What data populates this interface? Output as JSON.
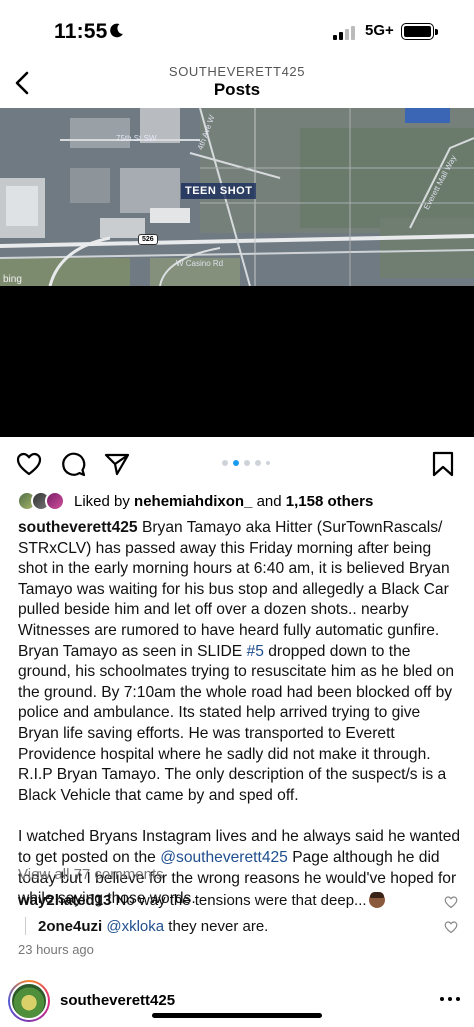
{
  "status_bar": {
    "time": "11:55",
    "network": "5G+",
    "icons": [
      "moon-icon",
      "signal-icon",
      "battery-icon"
    ]
  },
  "header": {
    "account": "SOUTHEVERETT425",
    "title": "Posts",
    "back_icon": "chevron-left-icon"
  },
  "media": {
    "map_overlay_label": "TEEN SHOT",
    "watermark": "bing",
    "map_labels": {
      "street_1": "75th St SW",
      "street_2": "W Casino Rd",
      "street_3": "Everett Mall Way",
      "street_4": "4th Ave W",
      "route": "526"
    },
    "carousel": {
      "total": 5,
      "active_index": 1
    }
  },
  "actions": {
    "icons": [
      "heart-icon",
      "comment-icon",
      "share-icon",
      "bookmark-icon"
    ]
  },
  "likes": {
    "prefix": "Liked by ",
    "user": "nehemiahdixon_",
    "middle": " and ",
    "count": "1,158 others"
  },
  "caption": {
    "username": "southeverett425",
    "text_part1": " Bryan Tamayo aka Hitter (SurTownRascals/ STRxCLV) has passed away this Friday morning after being shot in the early morning hours at 6:40 am, it is believed Bryan Tamayo was waiting for his bus stop and allegedly a Black Car pulled beside him and let off over a dozen shots.. nearby Witnesses are rumored to have heard fully automatic gunfire. Bryan Tamayo as seen in SLIDE ",
    "hashtag": "#5",
    "text_part2": " dropped down to the ground, his schoolmates trying to resuscitate him as he bled on the ground. By 7:10am the whole road had been blocked off by police and ambulance. Its stated help arrived trying to give Bryan life saving efforts. He was transported to Everett Providence hospital where he sadly did not make it through. R.I.P Bryan Tamayo. The only description of the suspect/s is a Black Vehicle that came by and sped off.",
    "para2_part1": "I watched Bryans Instagram lives and he always said he wanted to get posted on the ",
    "mention": "@southeverett425",
    "para2_part2": " Page although he did today but I believe for the wrong reasons he would've hoped for while saying those words."
  },
  "comments": {
    "view_all": "View all 77 comments",
    "items": [
      {
        "user": "way2hated13",
        "text": " No way the tensions were that deep...",
        "emoji": "facepalm-emoji"
      },
      {
        "user": "2one4uzi",
        "mention": "@xkloka",
        "text": " they never are."
      }
    ],
    "timestamp": "23 hours ago"
  },
  "next_post": {
    "username": "southeverett425"
  },
  "colors": {
    "link": "#1f4f8f",
    "carousel_active": "#1d9bf0",
    "muted_text": "#777777"
  }
}
